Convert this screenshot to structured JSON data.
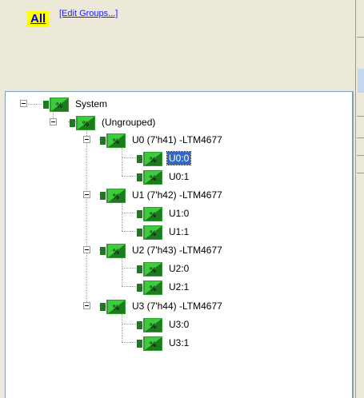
{
  "header": {
    "all_label": "All",
    "edit_groups_label": "[Edit Groups...]"
  },
  "tree": {
    "root": {
      "label": "System"
    },
    "group": {
      "label": "(Ungrouped)"
    },
    "devices": [
      {
        "label": "U0 (7'h41) -LTM4677",
        "channels": [
          "U0:0",
          "U0:1"
        ]
      },
      {
        "label": "U1 (7'h42) -LTM4677",
        "channels": [
          "U1:0",
          "U1:1"
        ]
      },
      {
        "label": "U2 (7'h43) -LTM4677",
        "channels": [
          "U2:0",
          "U2:1"
        ]
      },
      {
        "label": "U3 (7'h44) -LTM4677",
        "channels": [
          "U3:0",
          "U3:1"
        ]
      }
    ],
    "selected": "U0:0"
  },
  "colors": {
    "icon_green_dark": "#1e7a1e",
    "icon_green_light": "#3ecb3e",
    "selection": "#316ac5"
  }
}
